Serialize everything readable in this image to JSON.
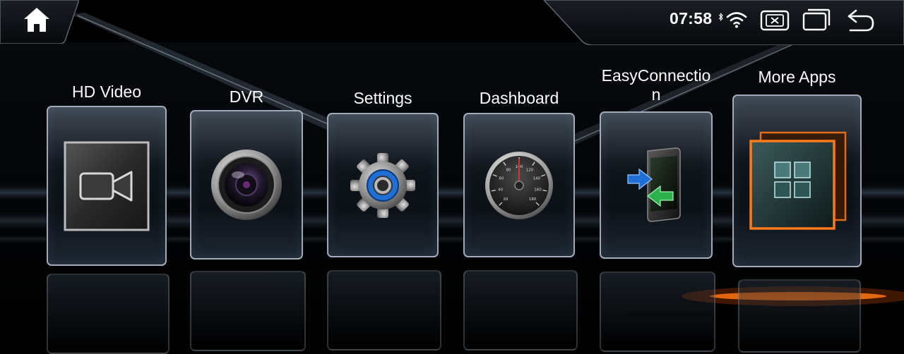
{
  "status_bar": {
    "time": "07:58",
    "icons": [
      "home-icon",
      "bluetooth-icon",
      "wifi-icon",
      "close-window-icon",
      "recent-apps-icon",
      "back-arrow-icon"
    ]
  },
  "apps": [
    {
      "label": "HD Video",
      "icon": "video-camera-icon"
    },
    {
      "label": "DVR",
      "icon": "camera-lens-icon"
    },
    {
      "label": "Settings",
      "icon": "gear-icon"
    },
    {
      "label": "Dashboard",
      "icon": "speedometer-icon"
    },
    {
      "label": "EasyConnectio\nn",
      "icon": "phone-connection-icon"
    },
    {
      "label": "More Apps",
      "icon": "app-grid-icon"
    }
  ],
  "speedometer_ticks": [
    "20",
    "40",
    "60",
    "80",
    "100",
    "120",
    "140",
    "160",
    "180"
  ],
  "colors": {
    "accent_blue": "#1f6fd6",
    "accent_orange": "#ff7a1a",
    "accent_green": "#2bb24c"
  }
}
